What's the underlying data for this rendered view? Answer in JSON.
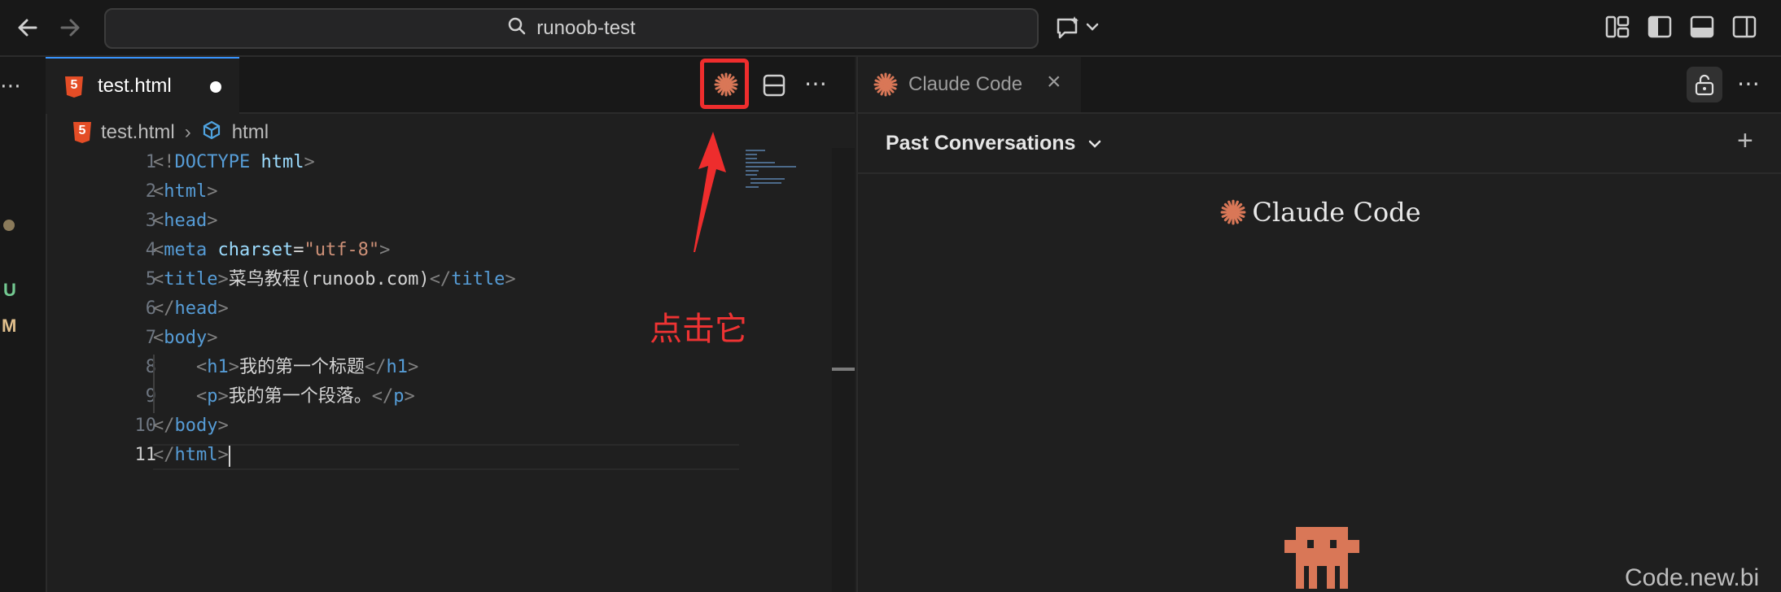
{
  "titlebar": {
    "search_text": "runoob-test"
  },
  "activity": {
    "badge_u": "U",
    "badge_m": "M"
  },
  "editor": {
    "tab_label": "test.html",
    "breadcrumb_file": "test.html",
    "breadcrumb_symbol": "html",
    "lines": [
      {
        "n": "1"
      },
      {
        "n": "2"
      },
      {
        "n": "3"
      },
      {
        "n": "4"
      },
      {
        "n": "5"
      },
      {
        "n": "6"
      },
      {
        "n": "7"
      },
      {
        "n": "8"
      },
      {
        "n": "9"
      },
      {
        "n": "10"
      },
      {
        "n": "11"
      }
    ],
    "code": {
      "l1_doctype": "<!",
      "l1_kw": "DOCTYPE",
      "l1_html": "html",
      "l1_end": ">",
      "tag_html": "html",
      "tag_head": "head",
      "tag_meta": "meta",
      "attr_charset": "charset",
      "val_charset": "\"utf-8\"",
      "tag_title": "title",
      "title_text": "菜鸟教程(runoob.com)",
      "tag_body": "body",
      "tag_h1": "h1",
      "h1_text": "我的第一个标题",
      "tag_p": "p",
      "p_text": "我的第一个段落。"
    }
  },
  "annotation": {
    "text": "点击它"
  },
  "panel": {
    "tab_label": "Claude Code",
    "past_conversations": "Past Conversations",
    "brand_name": "Claude Code",
    "plus": "+"
  },
  "watermark": "Code.new.bi",
  "colors": {
    "accent": "#d97757",
    "highlight": "#ee2d2d",
    "tag": "#569cd6",
    "string": "#ce9178",
    "attr": "#9cdcfe"
  },
  "icons": [
    "back-arrow-icon",
    "forward-arrow-icon",
    "search-icon",
    "chat-sparkle-icon",
    "chevron-down-icon",
    "layout-icon",
    "sidebar-left-icon",
    "panel-bottom-icon",
    "sidebar-right-icon",
    "html5-icon",
    "claude-asterisk-icon",
    "split-editor-icon",
    "more-icon",
    "close-icon",
    "lock-icon",
    "plus-icon",
    "symbol-icon",
    "pixel-mascot-icon"
  ]
}
